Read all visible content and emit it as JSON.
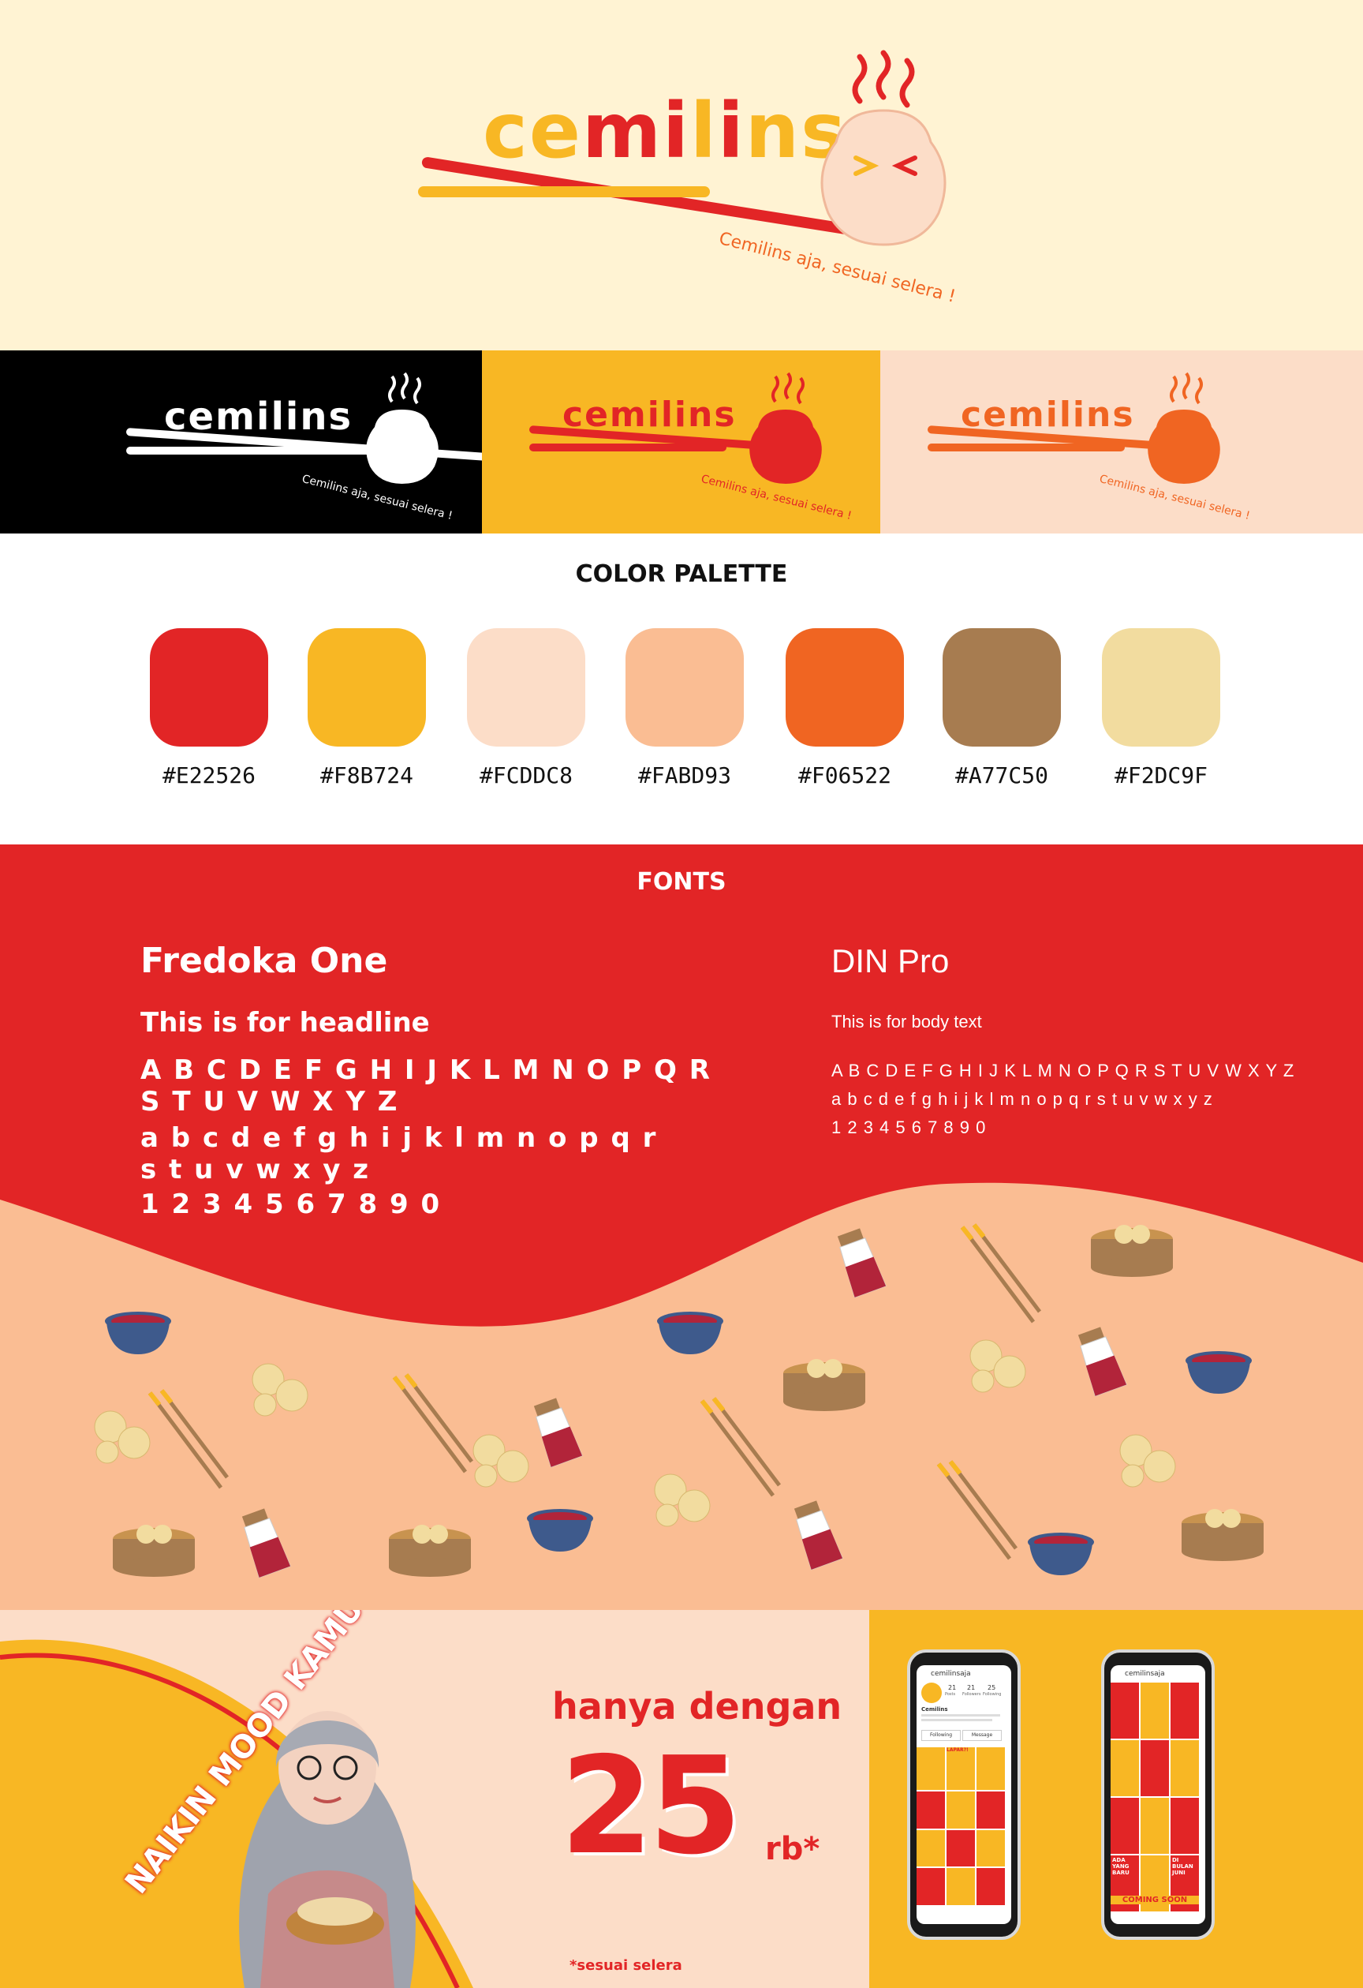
{
  "logo": {
    "wordmark": "cemilins",
    "tagline": "Cemilins aja, sesuai selera !"
  },
  "logo_variants": [
    {
      "bg": "#000000",
      "word": "#FFFFFF",
      "mascot": "#FFFFFF",
      "chop": "#FFFFFF",
      "tag": "#FFFFFF"
    },
    {
      "bg": "#F8B724",
      "word": "#E22526",
      "mascot": "#E22526",
      "chop": "#E22526",
      "tag": "#E22526"
    },
    {
      "bg": "#FCDDC8",
      "word": "#F06522",
      "mascot": "#F06522",
      "chop": "#F06522",
      "tag": "#F06522"
    }
  ],
  "palette": {
    "title": "COLOR PALETTE",
    "colors": [
      {
        "hex": "#E22526"
      },
      {
        "hex": "#F8B724"
      },
      {
        "hex": "#FCDDC8"
      },
      {
        "hex": "#FABD93"
      },
      {
        "hex": "#F06522"
      },
      {
        "hex": "#A77C50"
      },
      {
        "hex": "#F2DC9F"
      }
    ]
  },
  "fonts": {
    "title": "FONTS",
    "headline_font": {
      "name": "Fredoka One",
      "usage": "This is for headline",
      "upper1": "A B C D E F G H I J K L M N O P Q R",
      "upper2": "S T U V W X Y Z",
      "lower1": "a b c d e f g h i j k l m n o p q r",
      "lower2": "s t u v w x y z",
      "digits": "1 2 3 4 5 6 7 8 9 0"
    },
    "body_font": {
      "name": "DIN Pro",
      "usage": "This is for body text",
      "upper": "A B C D E F G H I J K L M N O P Q R S T U V W X Y Z",
      "lower": "a b c d e f g h i j k l m n o p q r s t u v w x y z",
      "digits": "1 2 3 4 5 6 7 8 9 0"
    }
  },
  "promo": {
    "arc_text": "NAIKIN MOOD KAMU",
    "price_intro": "hanya dengan",
    "price_value": "25",
    "price_unit": "rb*",
    "footnote": "*sesuai selera"
  },
  "phones": {
    "handle": "cemilinsaja",
    "stats": [
      "21",
      "21",
      "25"
    ],
    "stat_labels": [
      "Posts",
      "Followers",
      "Following"
    ],
    "bio_name": "Cemilins",
    "buttons": [
      "Following",
      "Message"
    ],
    "tiles": [
      "ADA YANG BARU",
      "DI BULAN JUNI",
      "COMING SOON",
      "LAPAR?!"
    ]
  }
}
